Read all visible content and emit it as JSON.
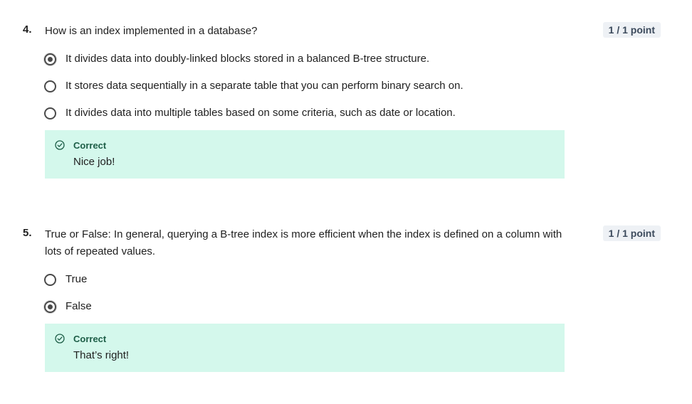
{
  "questions": [
    {
      "number": "4.",
      "text": "How is an index implemented in a database?",
      "points": "1 / 1 point",
      "options": [
        {
          "label": "It divides data into doubly-linked blocks stored in a balanced B-tree structure.",
          "selected": true
        },
        {
          "label": "It stores data sequentially in a separate table that you can perform binary search on.",
          "selected": false
        },
        {
          "label": "It divides data into multiple tables based on some criteria, such as date or location.",
          "selected": false
        }
      ],
      "feedback": {
        "title": "Correct",
        "message": "Nice job!",
        "icon": "check-circle-icon"
      }
    },
    {
      "number": "5.",
      "text": "True or False: In general, querying a B-tree index is more efficient when the index is defined on a column with lots of repeated values.",
      "points": "1 / 1 point",
      "options": [
        {
          "label": "True",
          "selected": false
        },
        {
          "label": "False",
          "selected": true
        }
      ],
      "feedback": {
        "title": "Correct",
        "message": "That’s right!",
        "icon": "check-circle-icon"
      }
    }
  ],
  "colors": {
    "feedback_bg": "#d4f8ec",
    "feedback_title": "#1d5e47",
    "points_bg": "#eef1f5"
  }
}
